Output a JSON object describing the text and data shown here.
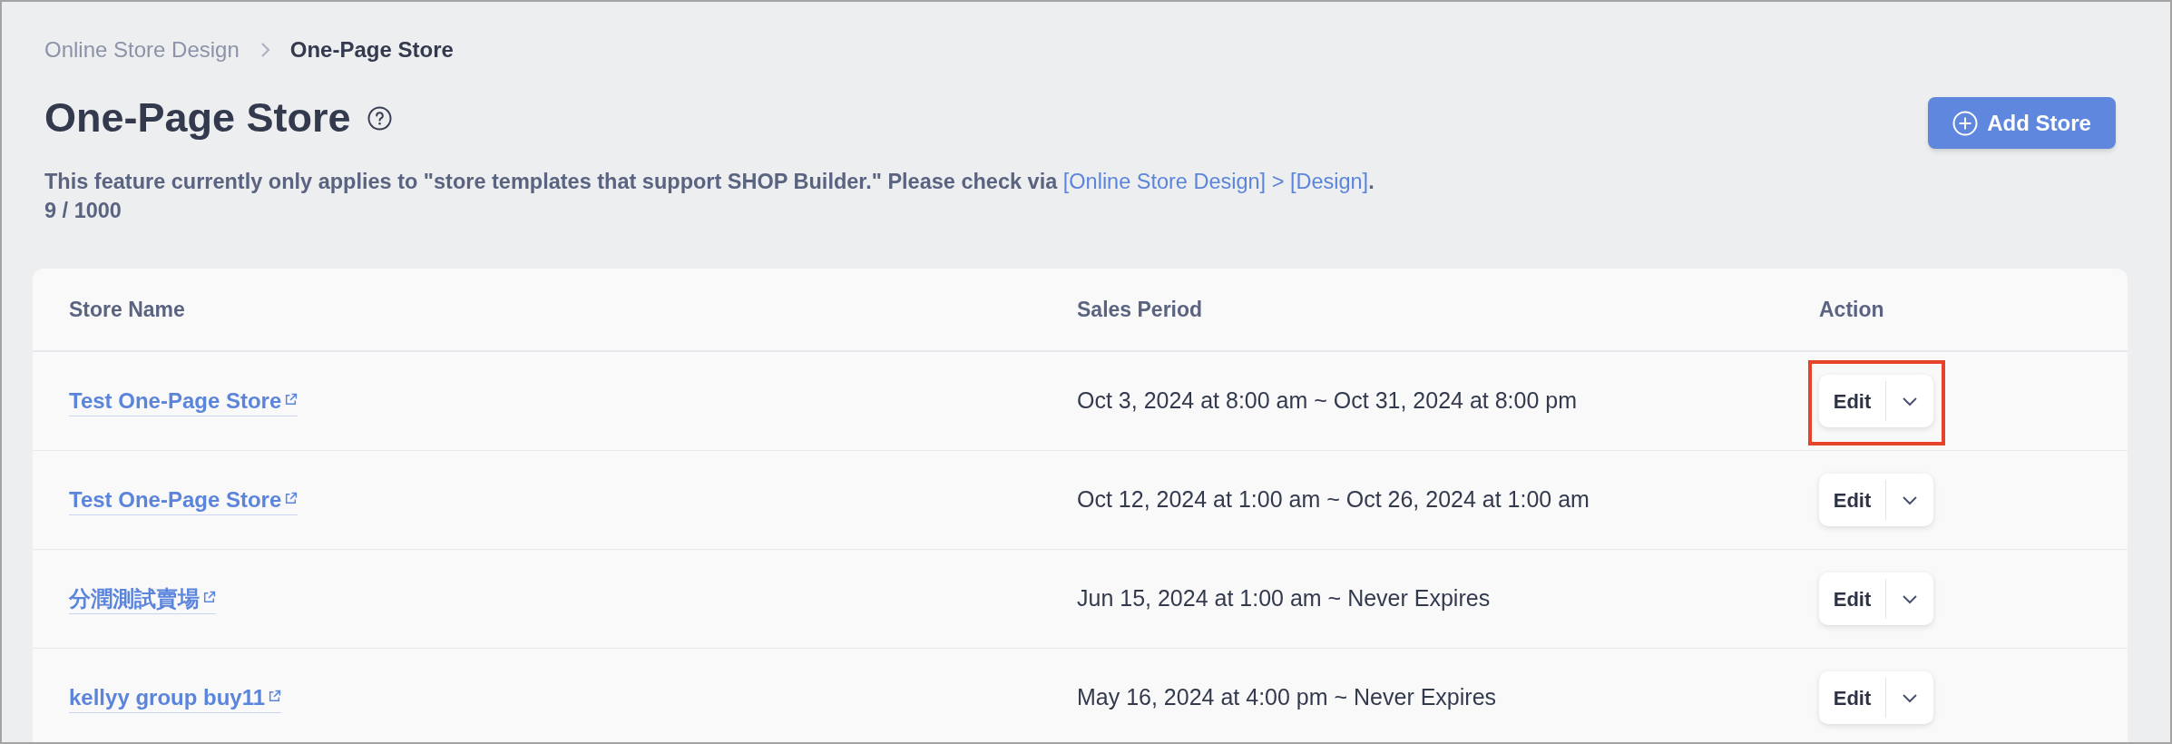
{
  "breadcrumb": [
    {
      "label": "Online Store Design",
      "current": false
    },
    {
      "label": "One-Page Store",
      "current": true
    }
  ],
  "page": {
    "title": "One-Page Store",
    "add_button": "Add Store"
  },
  "notice": {
    "text": "This feature currently only applies to \"store templates that support SHOP Builder.\" Please check via ",
    "link": "[Online Store Design] > [Design]",
    "end": "."
  },
  "count": "9 / 1000",
  "table": {
    "columns": [
      "Store Name",
      "Sales Period",
      "Action"
    ],
    "rows": [
      {
        "name": "Test One-Page Store",
        "sales_period": "Oct 3, 2024 at 8:00 am ~ Oct 31, 2024 at 8:00 pm",
        "action": "Edit",
        "highlighted": true
      },
      {
        "name": "Test One-Page Store",
        "sales_period": "Oct 12, 2024 at 1:00 am ~ Oct 26, 2024 at 1:00 am",
        "action": "Edit",
        "highlighted": false
      },
      {
        "name": "分潤測試賣場",
        "sales_period": "Jun 15, 2024 at 1:00 am ~ Never Expires",
        "action": "Edit",
        "highlighted": false
      },
      {
        "name": "kellyy group buy11",
        "sales_period": "May 16, 2024 at 4:00 pm ~ Never Expires",
        "action": "Edit",
        "highlighted": false
      }
    ]
  }
}
